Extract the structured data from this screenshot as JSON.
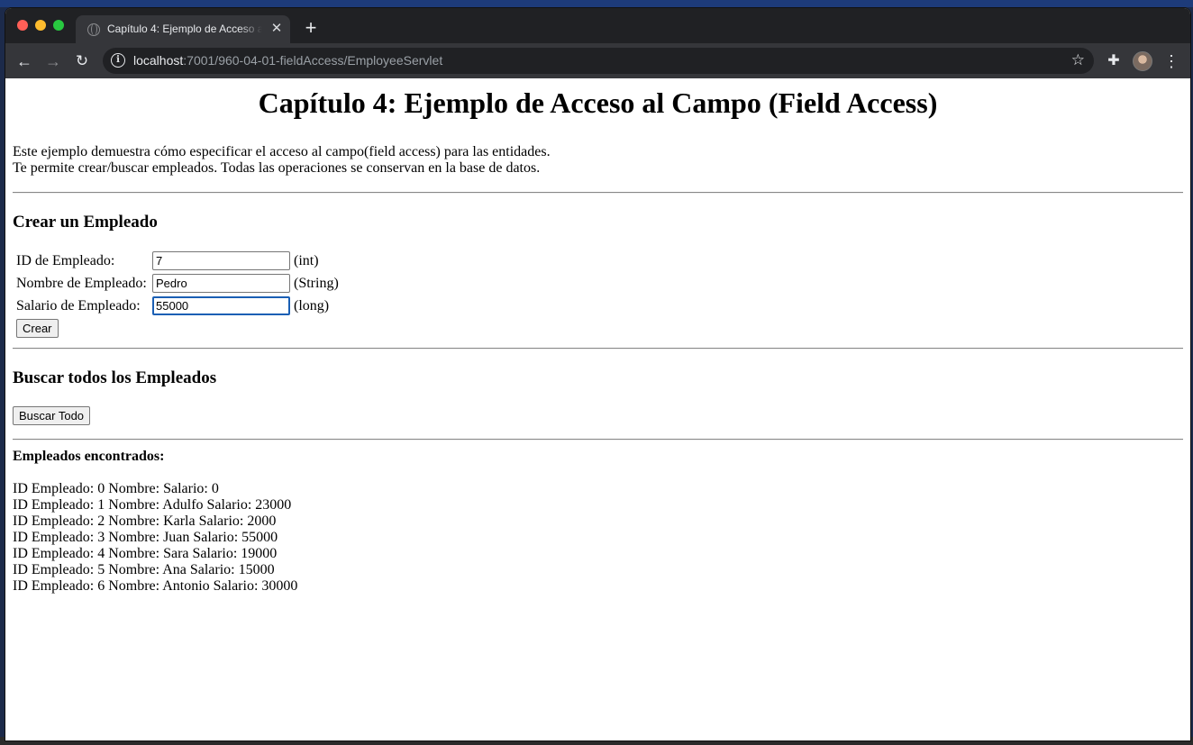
{
  "browser": {
    "tab_title": "Capítulo 4: Ejemplo de Acceso al Campo (Field Access)",
    "new_tab_symbol": "+",
    "url_host": "localhost",
    "url_rest": ":7001/960-04-01-fieldAccess/EmployeeServlet"
  },
  "page": {
    "heading": "Capítulo 4: Ejemplo de Acceso al Campo (Field Access)",
    "intro_line1": "Este ejemplo demuestra cómo especificar el acceso al campo(field access) para las entidades.",
    "intro_line2": "Te permite crear/buscar empleados. Todas las operaciones se conservan en la base de datos.",
    "create_section": {
      "title": "Crear un Empleado",
      "fields": [
        {
          "label": "ID de Empleado:",
          "value": "7",
          "type_hint": "(int)"
        },
        {
          "label": "Nombre de Empleado:",
          "value": "Pedro",
          "type_hint": "(String)"
        },
        {
          "label": "Salario de Empleado:",
          "value": "55000",
          "type_hint": "(long)"
        }
      ],
      "submit_label": "Crear"
    },
    "search_section": {
      "title": "Buscar todos los Empleados",
      "button_label": "Buscar Todo"
    },
    "results": {
      "title": "Empleados encontrados:",
      "rows": [
        "ID Empleado: 0 Nombre: Salario: 0",
        "ID Empleado: 1 Nombre: Adulfo Salario: 23000",
        "ID Empleado: 2 Nombre: Karla Salario: 2000",
        "ID Empleado: 3 Nombre: Juan Salario: 55000",
        "ID Empleado: 4 Nombre: Sara Salario: 19000",
        "ID Empleado: 5 Nombre: Ana Salario: 15000",
        "ID Empleado: 6 Nombre: Antonio Salario: 30000"
      ]
    }
  }
}
